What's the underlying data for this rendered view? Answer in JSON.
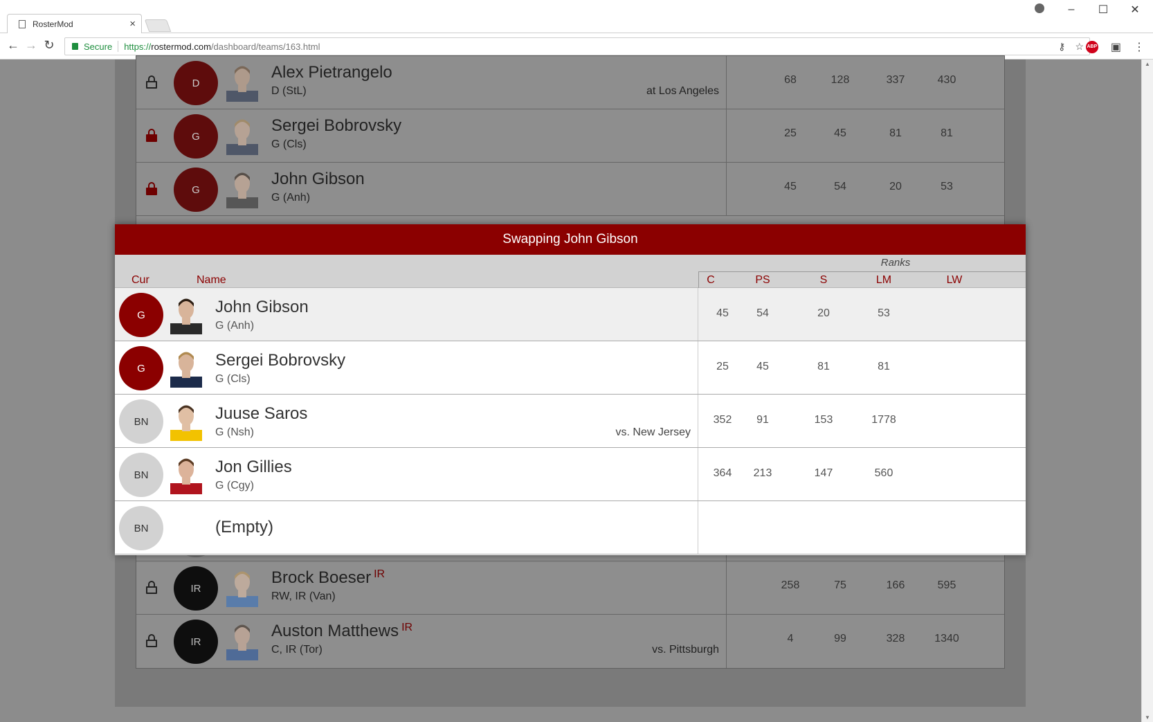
{
  "browser": {
    "tab_title": "RosterMod",
    "tab_close": "×",
    "secure_label": "Secure",
    "url_scheme": "https://",
    "url_host": "rostermod.com",
    "url_path": "/dashboard/teams/163.html",
    "abp_label": "ABP"
  },
  "background_roster": {
    "top_rows": [
      {
        "pos": "D",
        "name": "Alex Pietrangelo",
        "sub": "D (StL)",
        "opponent": "at Los Angeles",
        "locked": false,
        "stats": [
          "68",
          "128",
          "337",
          "430"
        ]
      },
      {
        "pos": "G",
        "name": "Sergei Bobrovsky",
        "sub": "G (Cls)",
        "opponent": "",
        "locked": true,
        "stats": [
          "25",
          "45",
          "81",
          "81"
        ]
      },
      {
        "pos": "G",
        "name": "John Gibson",
        "sub": "G (Anh)",
        "opponent": "",
        "locked": true,
        "stats": [
          "45",
          "54",
          "20",
          "53"
        ]
      }
    ],
    "bottom_rows": [
      {
        "pos": "BN",
        "name": "(Empty)",
        "sub": "",
        "opponent": "",
        "badge": "",
        "stats": [
          "",
          "",
          "",
          ""
        ]
      },
      {
        "pos": "IR",
        "name": "Brock Boeser",
        "sub": "RW, IR (Van)",
        "opponent": "",
        "badge": "IR",
        "stats": [
          "258",
          "75",
          "166",
          "595"
        ]
      },
      {
        "pos": "IR",
        "name": "Auston Matthews",
        "sub": "C, IR (Tor)",
        "opponent": "vs. Pittsburgh",
        "badge": "IR",
        "stats": [
          "4",
          "99",
          "328",
          "1340"
        ]
      }
    ]
  },
  "modal": {
    "title": "Swapping John Gibson",
    "ranks_label": "Ranks",
    "headers": {
      "cur": "Cur",
      "name": "Name",
      "c": "C",
      "ps": "PS",
      "s": "S",
      "lm": "LM",
      "lw": "LW"
    },
    "rows": [
      {
        "pos": "G",
        "name": "John Gibson",
        "sub": "G (Anh)",
        "opponent": "",
        "current": true,
        "stats": [
          "45",
          "54",
          "20",
          "53"
        ]
      },
      {
        "pos": "G",
        "name": "Sergei Bobrovsky",
        "sub": "G (Cls)",
        "opponent": "",
        "current": false,
        "stats": [
          "25",
          "45",
          "81",
          "81"
        ]
      },
      {
        "pos": "BN",
        "name": "Juuse Saros",
        "sub": "G (Nsh)",
        "opponent": "vs. New Jersey",
        "current": false,
        "stats": [
          "352",
          "91",
          "153",
          "1778"
        ]
      },
      {
        "pos": "BN",
        "name": "Jon Gillies",
        "sub": "G (Cgy)",
        "opponent": "",
        "current": false,
        "stats": [
          "364",
          "213",
          "147",
          "560"
        ]
      },
      {
        "pos": "BN",
        "name": "(Empty)",
        "sub": "",
        "opponent": "",
        "current": false,
        "stats": [
          "",
          "",
          "",
          ""
        ]
      }
    ]
  },
  "colors": {
    "accent": "#8b0000",
    "bench_circle": "#d2d2d2",
    "ir_badge": "#8b0000"
  }
}
